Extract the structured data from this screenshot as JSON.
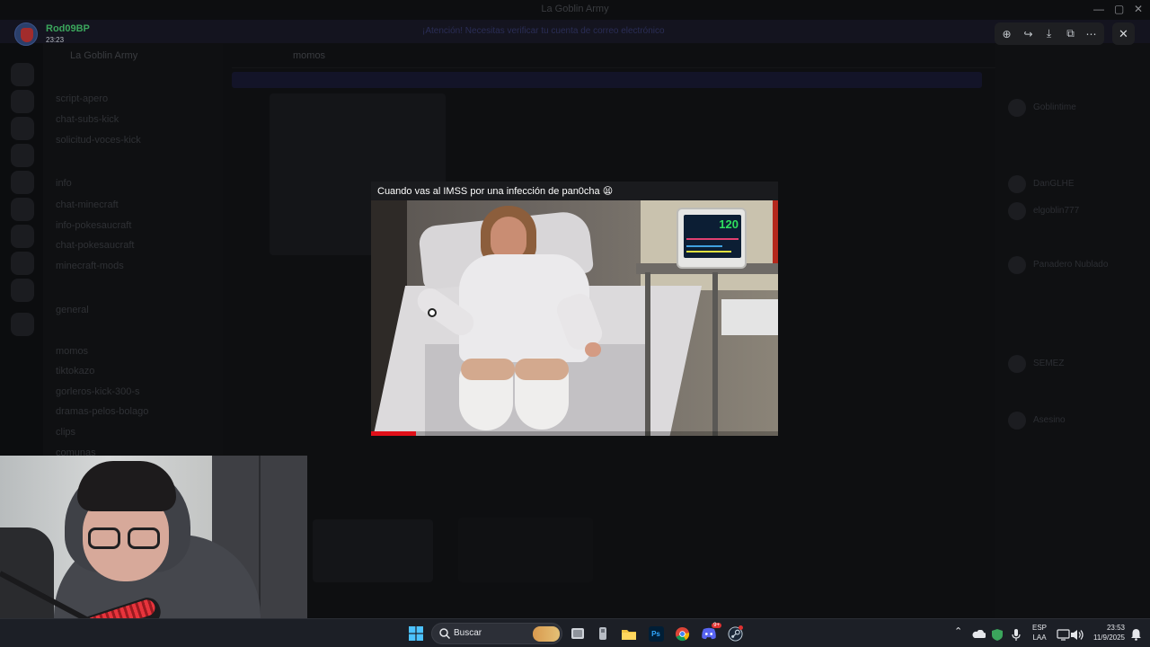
{
  "window": {
    "title": "La Goblin Army",
    "minimize_glyph": "—",
    "maximize_glyph": "▢",
    "close_glyph": "✕"
  },
  "banner": {
    "text": "¡Atención! Necesitas verificar tu cuenta de correo electrónico"
  },
  "background": {
    "guild_name": "La Goblin Army",
    "channels": [
      "script-apero",
      "chat-subs-kick",
      "solicitud-voces-kick",
      "info",
      "chat-minecraft",
      "info-pokesaucraft",
      "chat-pokesaucraft",
      "minecraft-mods",
      "general",
      "momos",
      "tiktokazo",
      "gorleros-kick-300-s",
      "dramas-pelos-bolago",
      "clips",
      "comunas"
    ],
    "channel_header": "momos",
    "members": [
      "Goblintime",
      "DanGLHE",
      "elgoblin777",
      "Panadero Nublado",
      "SEMEZ",
      "Asesino"
    ]
  },
  "viewer": {
    "username": "Rod09BP",
    "timestamp": "23:23",
    "avatar_color": "#2b3f6a",
    "tools": [
      {
        "name": "zoom-in-icon",
        "glyph": "⊕"
      },
      {
        "name": "forward-icon",
        "glyph": "↪"
      },
      {
        "name": "download-icon",
        "glyph": "⤓"
      },
      {
        "name": "open-external-icon",
        "glyph": "⧉"
      },
      {
        "name": "more-options-icon",
        "glyph": "⋯"
      }
    ],
    "close_glyph": "✕"
  },
  "media": {
    "caption": "Cuando vas al IMSS por una infección de pan0cha 😫",
    "monitor_reading": "120",
    "progress": 0.11,
    "progress_color": "#e0101a"
  },
  "taskbar": {
    "search_placeholder": "Buscar",
    "apps": [
      {
        "name": "task-view-icon"
      },
      {
        "name": "app-icon"
      },
      {
        "name": "file-explorer-icon"
      },
      {
        "name": "photoshop-icon",
        "label": "Ps"
      },
      {
        "name": "chrome-icon"
      },
      {
        "name": "discord-icon",
        "badge": "9+"
      },
      {
        "name": "steam-icon"
      }
    ],
    "language": {
      "line1": "ESP",
      "line2": "LAA"
    },
    "time": "23:53",
    "date": "11/9/2025",
    "tray_up_glyph": "⌃"
  },
  "colors": {
    "accent": "#5865f2",
    "username": "#3ba55c",
    "taskbar": "#1c1f26"
  }
}
